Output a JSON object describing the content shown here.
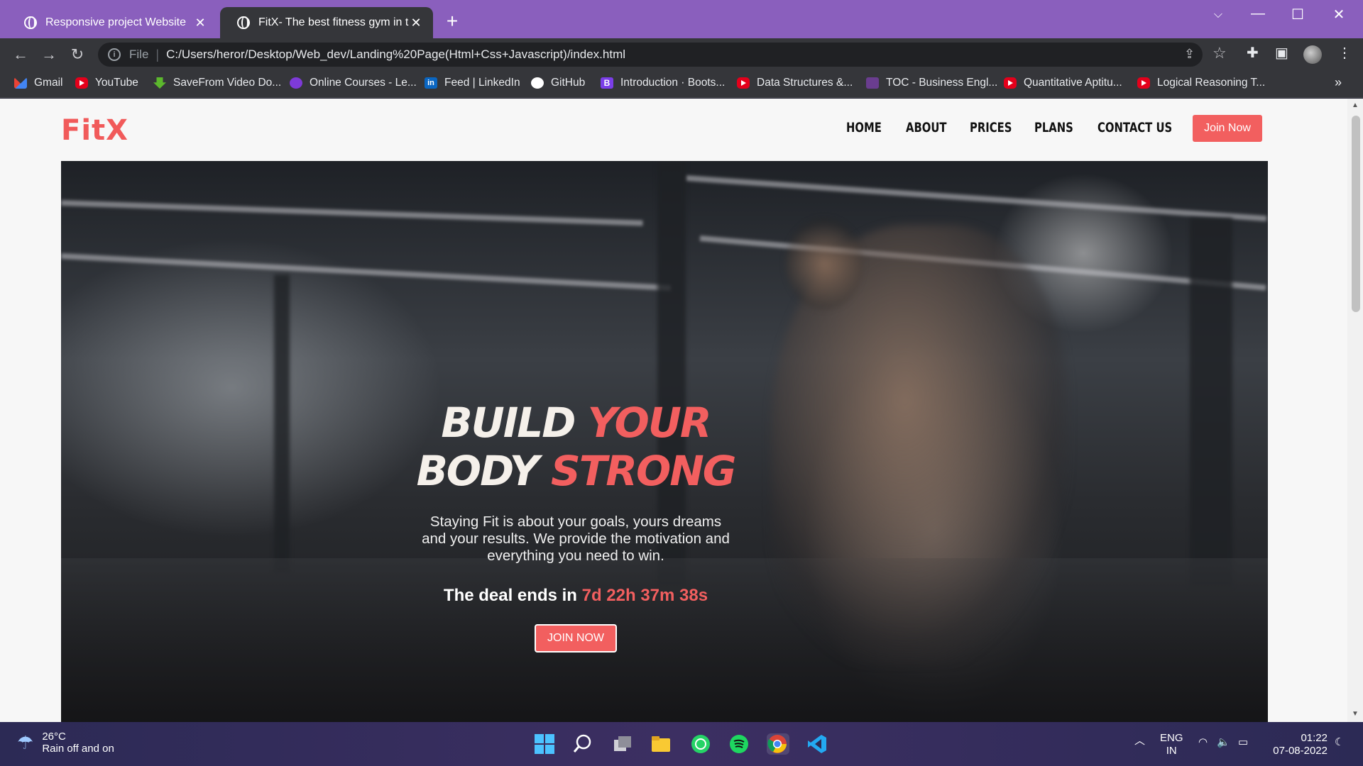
{
  "browser": {
    "tabs": [
      {
        "title": "Responsive project Website"
      },
      {
        "title": "FitX- The best fitness gym in the"
      }
    ],
    "address": {
      "scheme": "File",
      "url": "C:/Users/heror/Desktop/Web_dev/Landing%20Page(Html+Css+Javascript)/index.html"
    },
    "bookmarks": [
      {
        "label": "Gmail",
        "icon": "gmail-icon"
      },
      {
        "label": "YouTube",
        "icon": "youtube-icon"
      },
      {
        "label": "SaveFrom Video Do...",
        "icon": "download-arrow-icon"
      },
      {
        "label": "Online Courses - Le...",
        "icon": "udemy-icon"
      },
      {
        "label": "Feed | LinkedIn",
        "icon": "linkedin-icon"
      },
      {
        "label": "GitHub",
        "icon": "github-icon"
      },
      {
        "label": "Introduction · Boots...",
        "icon": "bootstrap-icon"
      },
      {
        "label": "Data Structures &...",
        "icon": "youtube-icon"
      },
      {
        "label": "TOC - Business Engl...",
        "icon": "toc-icon"
      },
      {
        "label": "Quantitative Aptitu...",
        "icon": "youtube-icon"
      },
      {
        "label": "Logical Reasoning T...",
        "icon": "youtube-icon"
      }
    ]
  },
  "site": {
    "logo": "FitX",
    "nav": [
      "HOME",
      "ABOUT",
      "PRICES",
      "PLANS",
      "CONTACT US"
    ],
    "join_top": "Join Now",
    "hero": {
      "line1_a": "BUILD",
      "line1_b": "YOUR",
      "line2_a": "BODY",
      "line2_b": "STRONG",
      "tagline": "Staying Fit is about your goals, yours dreams and your results. We provide the motivation and everything you need to win.",
      "deal_prefix": "The deal ends in",
      "countdown": "7d 22h 37m 38s",
      "cta": "JOIN NOW"
    },
    "colors": {
      "accent": "#f25f5f",
      "tabbar": "#8a5fbd"
    }
  },
  "taskbar": {
    "weather_temp": "26°C",
    "weather_desc": "Rain off and on",
    "lang_1": "ENG",
    "lang_2": "IN",
    "time": "01:22",
    "date": "07-08-2022"
  }
}
